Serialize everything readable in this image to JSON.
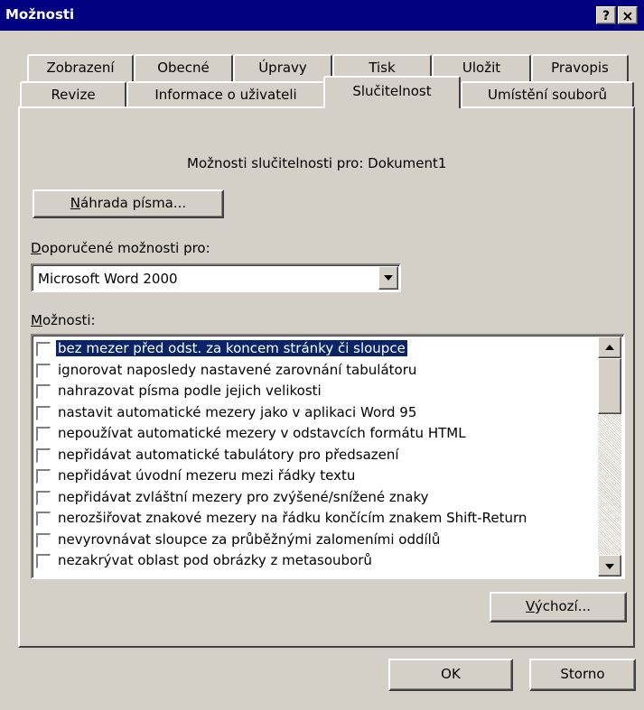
{
  "window": {
    "title": "Možnosti",
    "help_button": "?",
    "close_button": "×"
  },
  "tabs": {
    "row_back": [
      "Zobrazení",
      "Obecné",
      "Úpravy",
      "Tisk",
      "Uložit",
      "Pravopis"
    ],
    "row_front": [
      "Revize",
      "Informace o uživateli",
      "Slučitelnost",
      "Umístění souborů"
    ],
    "active": "Slučitelnost"
  },
  "panel": {
    "heading": "Možnosti slučitelnosti pro: Dokument1",
    "font_substitution_button": {
      "accel": "N",
      "rest": "áhrada písma..."
    },
    "recommended_label": {
      "accel": "D",
      "rest": "oporučené možnosti pro:"
    },
    "recommended_value": "Microsoft Word 2000",
    "options_label": {
      "accel": "M",
      "rest": "ožnosti:"
    },
    "options": [
      {
        "label": "bez mezer před odst. za koncem stránky či sloupce",
        "checked": false,
        "selected": true
      },
      {
        "label": "ignorovat naposledy nastavené zarovnání tabulátoru",
        "checked": false,
        "selected": false
      },
      {
        "label": "nahrazovat písma podle jejich velikosti",
        "checked": false,
        "selected": false
      },
      {
        "label": "nastavit automatické mezery jako v aplikaci Word 95",
        "checked": false,
        "selected": false
      },
      {
        "label": "nepoužívat automatické mezery v odstavcích formátu HTML",
        "checked": false,
        "selected": false
      },
      {
        "label": "nepřidávat automatické tabulátory pro předsazení",
        "checked": false,
        "selected": false
      },
      {
        "label": "nepřidávat úvodní mezeru mezi řádky textu",
        "checked": false,
        "selected": false
      },
      {
        "label": "nepřidávat zvláštní mezery pro zvýšené/snížené znaky",
        "checked": false,
        "selected": false
      },
      {
        "label": "nerozšiřovat znakové mezery na řádku končícím znakem Shift-Return",
        "checked": false,
        "selected": false
      },
      {
        "label": "nevyrovnávat sloupce za průběžnými zalomeními oddílů",
        "checked": false,
        "selected": false
      },
      {
        "label": "nezakrývat oblast pod obrázky z metasouborů",
        "checked": false,
        "selected": false
      }
    ],
    "default_button": {
      "accel": "V",
      "rest": "ýchozí..."
    }
  },
  "footer": {
    "ok_label": "OK",
    "cancel_label": "Storno"
  }
}
